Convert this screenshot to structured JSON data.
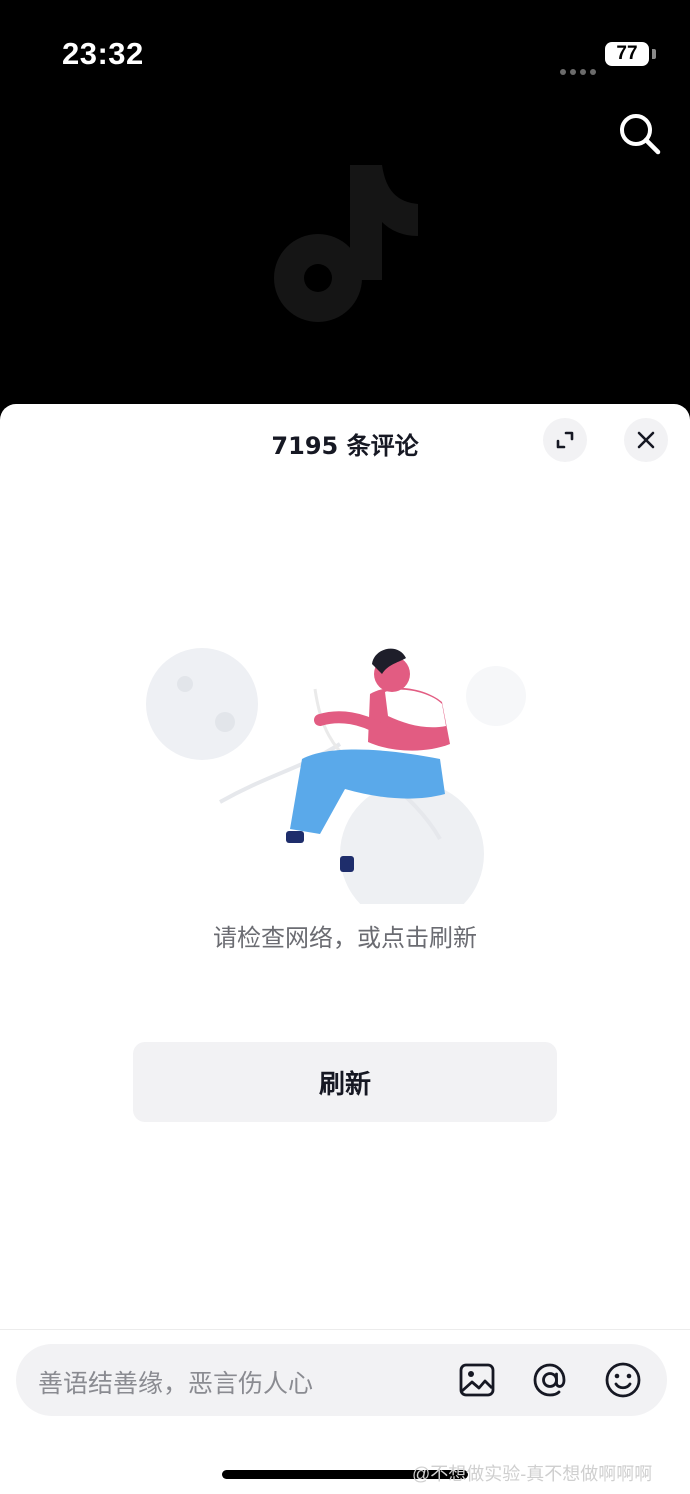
{
  "status_bar": {
    "time": "23:32",
    "battery_level": "77"
  },
  "comments_sheet": {
    "title": "7195 条评论",
    "empty_message": "请检查网络，或点击刷新",
    "refresh_label": "刷新"
  },
  "comment_input": {
    "placeholder": "善语结善缘，恶言伤人心",
    "icons": [
      "image-icon",
      "at-icon",
      "emoji-icon"
    ]
  },
  "watermark": "@不想做实验-真不想做啊啊啊",
  "colors": {
    "sheet_bg": "#ffffff",
    "app_bg": "#000000",
    "button_bg": "#f2f2f4",
    "text_primary": "#161823",
    "text_secondary": "#6b6c72"
  }
}
